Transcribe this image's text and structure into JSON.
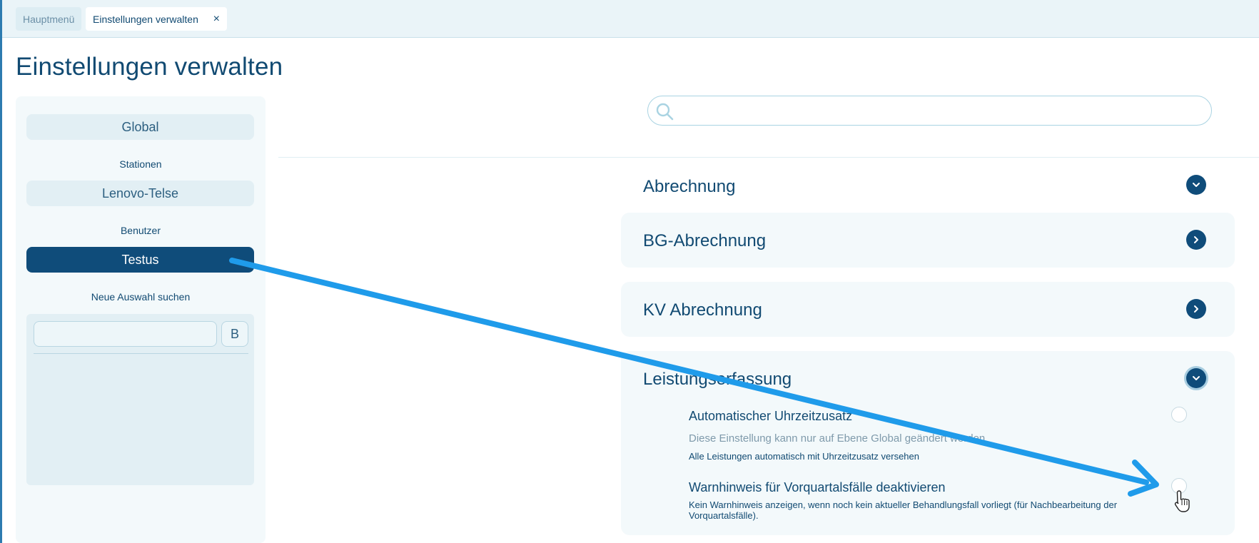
{
  "tabs": [
    {
      "label": "Hauptmenü"
    },
    {
      "label": "Einstellungen verwalten",
      "close": "×"
    }
  ],
  "page_title": "Einstellungen verwalten",
  "left_panel": {
    "global_label": "Global",
    "stations_heading": "Stationen",
    "station_label": "Lenovo-Telse",
    "users_heading": "Benutzer",
    "user_label": "Testus",
    "new_selection_heading": "Neue Auswahl suchen",
    "search_button_label": "B"
  },
  "sections": [
    {
      "title": "Abrechnung",
      "state": "expanded"
    },
    {
      "title": "BG-Abrechnung",
      "state": "collapsed"
    },
    {
      "title": "KV Abrechnung",
      "state": "collapsed"
    },
    {
      "title": "Leistungserfassung",
      "state": "expanded"
    }
  ],
  "options": [
    {
      "title": "Automatischer Uhrzeitzusatz",
      "note": "Diese Einstellung kann nur auf Ebene Global geändert werden",
      "description": "Alle Leistungen automatisch mit Uhrzeitzusatz versehen",
      "checked": false
    },
    {
      "title": "Warnhinweis für Vorquartalsfälle deaktivieren",
      "description_line1": "Kein Warnhinweis anzeigen, wenn noch kein aktueller Behandlungsfall vorliegt (für Nachbearbeitung der",
      "description_line2": "Vorquartalsfälle).",
      "checked": false
    }
  ],
  "icons": {
    "search": "search-icon",
    "expand": "chevron-down-icon",
    "collapse": "chevron-right-icon",
    "close": "close-icon",
    "cursor": "hand-pointer-icon"
  },
  "colors": {
    "primary": "#0f4c7a",
    "panel": "#f3f9fb",
    "annotation_arrow": "#1f9bea"
  }
}
